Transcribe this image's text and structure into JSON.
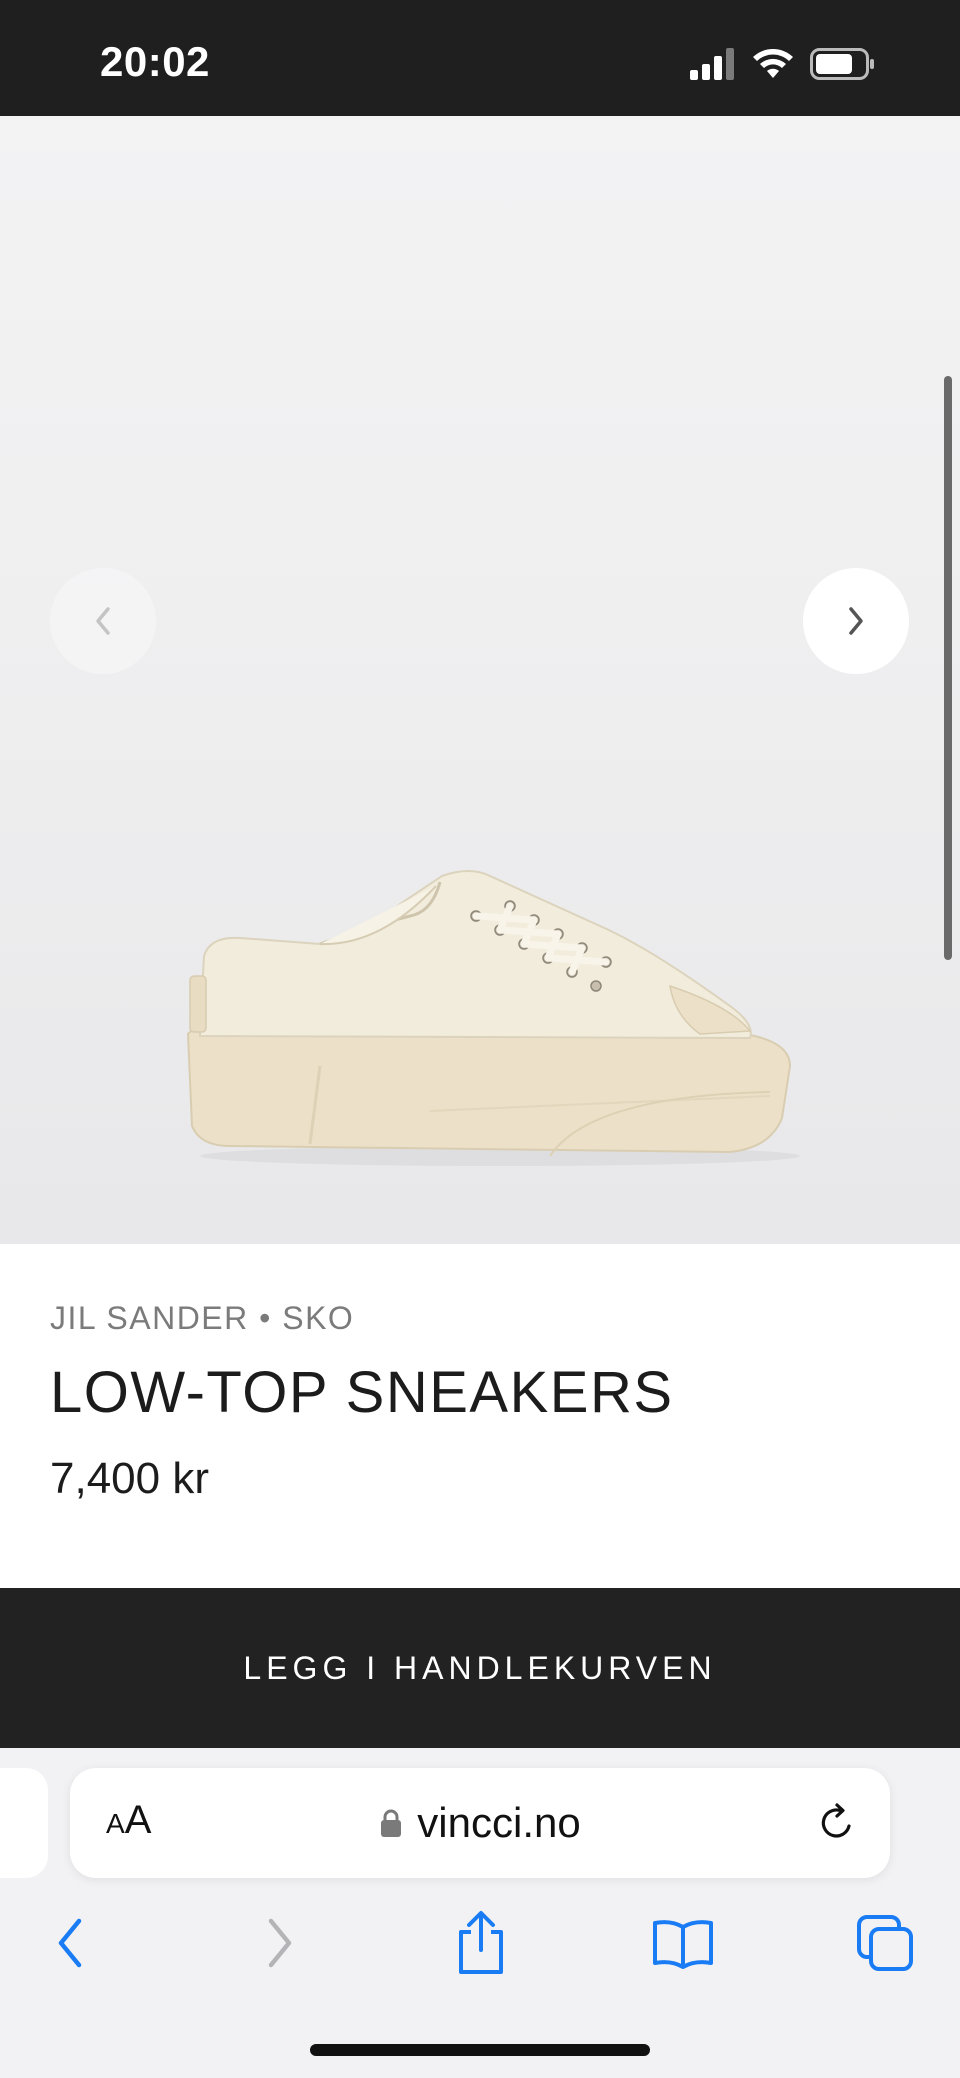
{
  "status_bar": {
    "time": "20:02",
    "icons": [
      "signal-icon",
      "wifi-icon",
      "battery-icon"
    ]
  },
  "gallery": {
    "prev_icon": "chevron-left-icon",
    "next_icon": "chevron-right-icon",
    "image_alt": "Low-top sneakers, off-white canvas with cream rubber sole"
  },
  "product": {
    "brand_line": "JIL SANDER • SKO",
    "title": "LOW-TOP SNEAKERS",
    "price": "7,400 kr"
  },
  "cart": {
    "button_label": "LEGG I HANDLEKURVEN"
  },
  "browser": {
    "text_size_small": "A",
    "text_size_big": "A",
    "url": "vincci.no",
    "lock_icon": "lock-icon",
    "reload_icon": "reload-icon",
    "toolbar": [
      "back-icon",
      "forward-icon",
      "share-icon",
      "bookmarks-icon",
      "tabs-icon"
    ]
  },
  "colors": {
    "dark": "#1f1f1f",
    "accent": "#1a7cf5",
    "muted": "#7b7b7b"
  }
}
